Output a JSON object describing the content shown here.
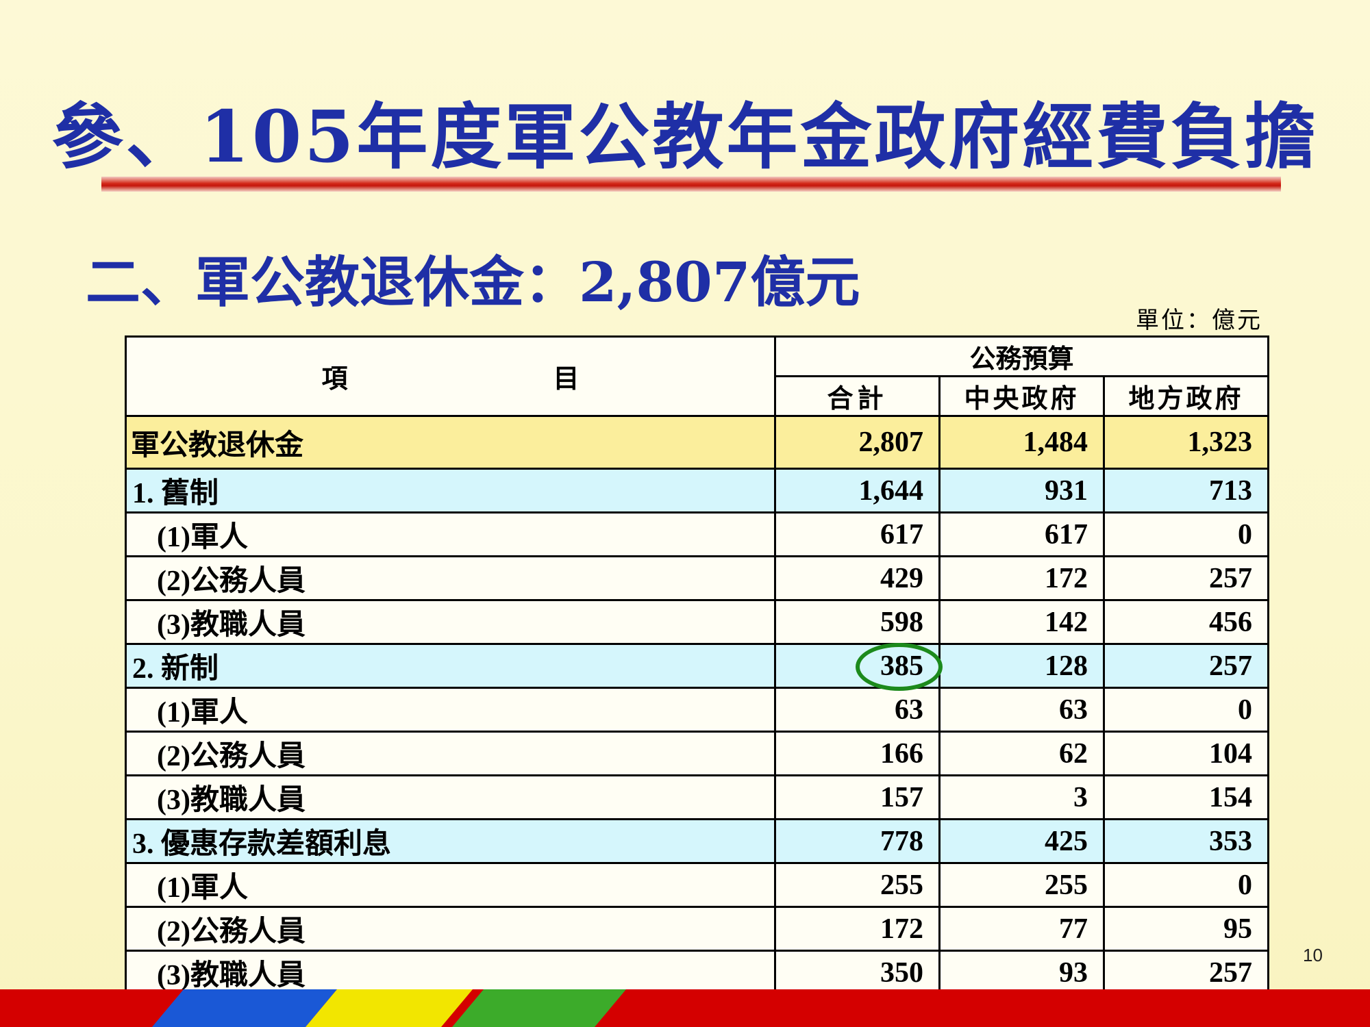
{
  "slide": {
    "title": "參、105年度軍公教年金政府經費負擔",
    "subtitle": "二、軍公教退休金：2,807億元",
    "unit": "單位：億元",
    "page_number": "10"
  },
  "table": {
    "header": {
      "item_label_1": "項",
      "item_label_2": "目",
      "group_label": "公務預算",
      "col_total": "合計",
      "col_central": "中央政府",
      "col_local": "地方政府"
    },
    "rows": [
      {
        "label": "軍公教退休金",
        "total": "2,807",
        "central": "1,484",
        "local": "1,323",
        "kind": "total"
      },
      {
        "label": "1. 舊制",
        "total": "1,644",
        "central": "931",
        "local": "713",
        "kind": "cat"
      },
      {
        "label": "(1)軍人",
        "total": "617",
        "central": "617",
        "local": "0",
        "kind": "sub"
      },
      {
        "label": "(2)公務人員",
        "total": "429",
        "central": "172",
        "local": "257",
        "kind": "sub"
      },
      {
        "label": "(3)教職人員",
        "total": "598",
        "central": "142",
        "local": "456",
        "kind": "sub"
      },
      {
        "label": "2. 新制",
        "total": "385",
        "central": "128",
        "local": "257",
        "kind": "cat",
        "highlight_total": true
      },
      {
        "label": "(1)軍人",
        "total": "63",
        "central": "63",
        "local": "0",
        "kind": "sub"
      },
      {
        "label": "(2)公務人員",
        "total": "166",
        "central": "62",
        "local": "104",
        "kind": "sub"
      },
      {
        "label": "(3)教職人員",
        "total": "157",
        "central": "3",
        "local": "154",
        "kind": "sub"
      },
      {
        "label": "3. 優惠存款差額利息",
        "total": "778",
        "central": "425",
        "local": "353",
        "kind": "cat"
      },
      {
        "label": "(1)軍人",
        "total": "255",
        "central": "255",
        "local": "0",
        "kind": "sub"
      },
      {
        "label": "(2)公務人員",
        "total": "172",
        "central": "77",
        "local": "95",
        "kind": "sub"
      },
      {
        "label": "(3)教職人員",
        "total": "350",
        "central": "93",
        "local": "257",
        "kind": "sub"
      }
    ]
  },
  "colors": {
    "title": "#1f2fa6",
    "total_row": "#fbee9c",
    "category_row": "#d5f6fc",
    "circle": "#1c8a1c",
    "footer_red": "#d40000",
    "footer_blue": "#1a58d6",
    "footer_yellow": "#f2e600",
    "footer_green": "#3cab2a"
  }
}
